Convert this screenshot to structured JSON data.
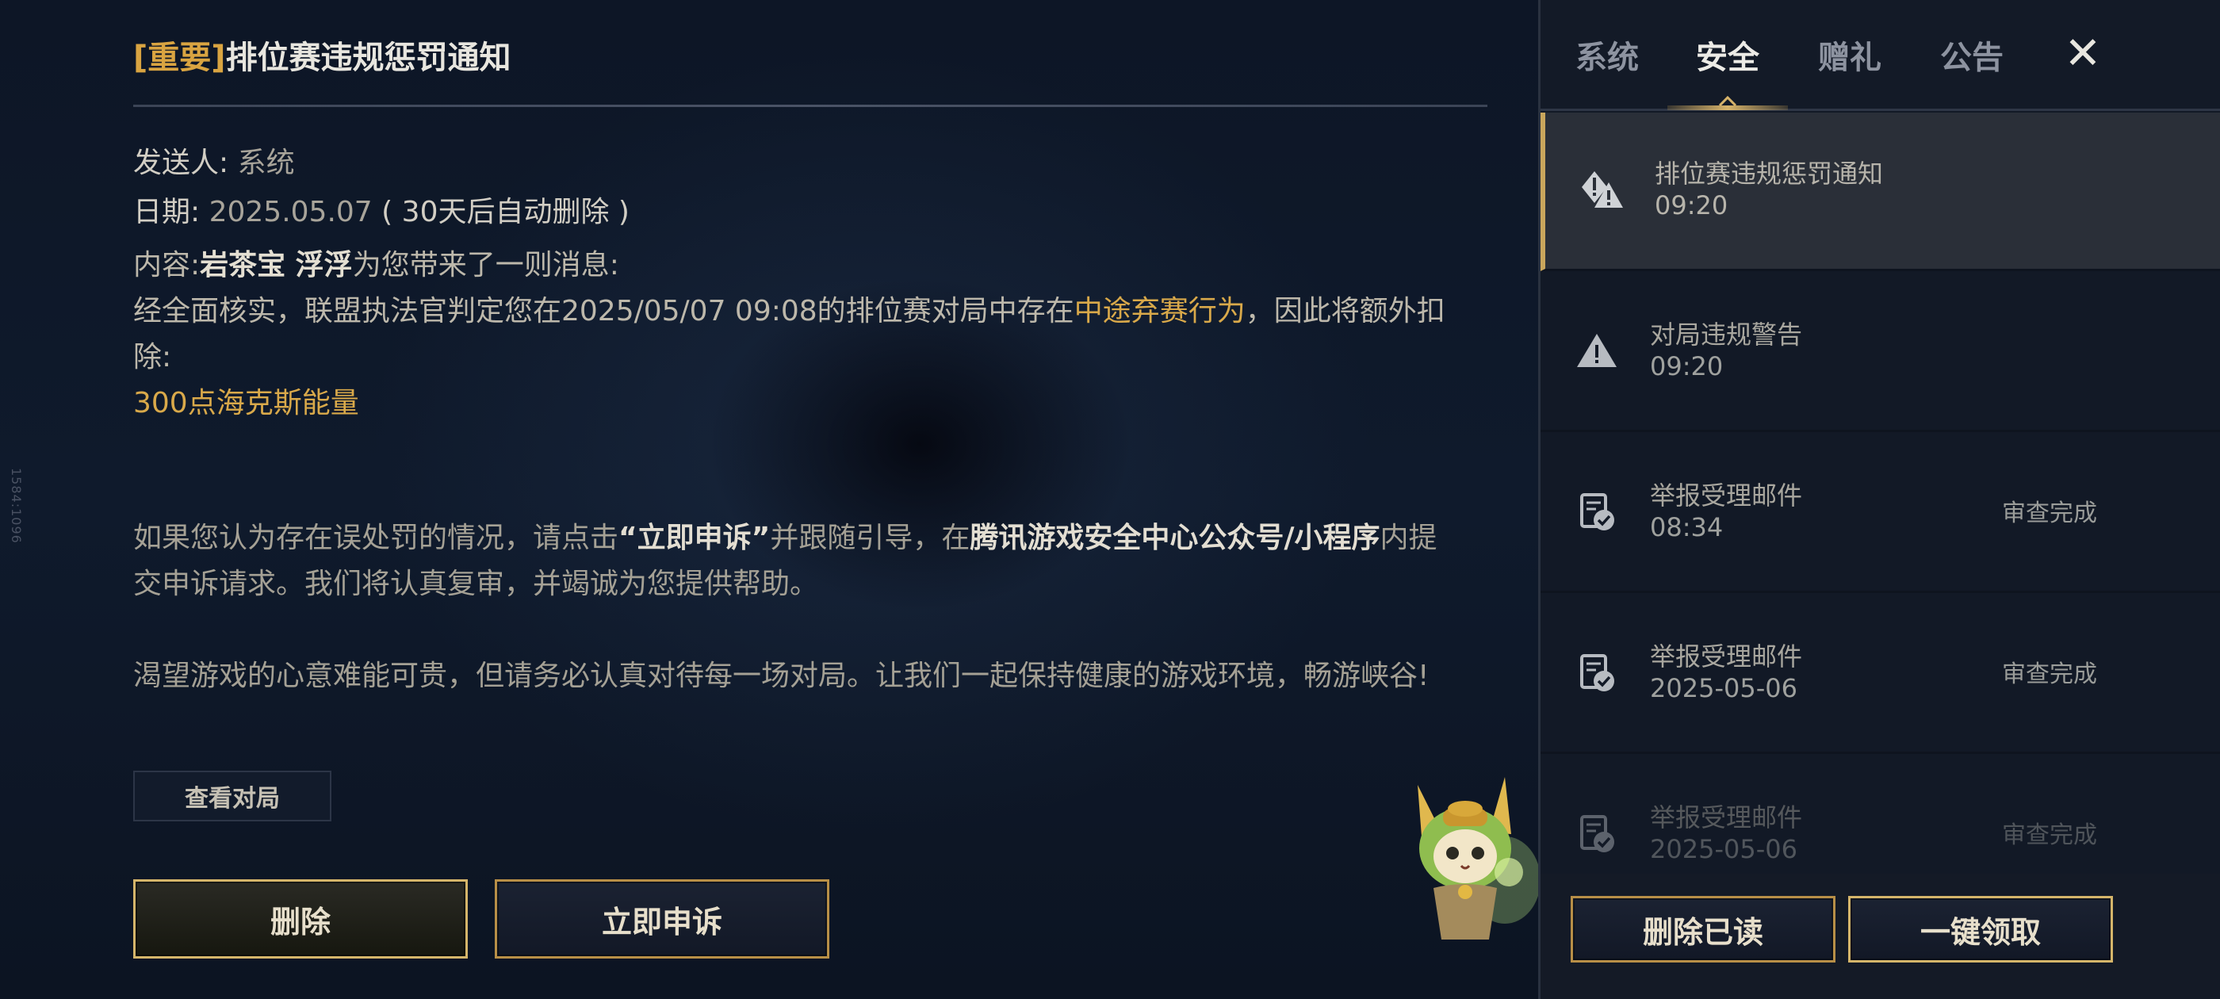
{
  "side_id": "1584:1096",
  "mail": {
    "title_tag": "[重要]",
    "title": "排位赛违规惩罚通知",
    "sender_label": "发送人:",
    "sender": "系统",
    "date_label": "日期:",
    "date": "2025.05.07",
    "date_note": "( 30天后自动删除 )",
    "content_label": "内容:",
    "content_from": "岩茶宝 浮浮",
    "content_intro": "为您带来了一则消息:",
    "content_body_1": "经全面核实，联盟执法官判定您在2025/05/07 09:08的排位赛对局中存在",
    "content_violation": "中途弃赛行为",
    "content_body_2": "，因此将额外扣除:",
    "penalty": "300点海克斯能量",
    "appeal_1": "如果您认为存在误处罚的情况，请点击",
    "appeal_link": "“立即申诉”",
    "appeal_2": "并跟随引导，在",
    "appeal_channel": "腾讯游戏安全中心公众号/小程序",
    "appeal_3": "内提交申诉请求。我们将认真复审，并竭诚为您提供帮助。",
    "closing": "渴望游戏的心意难能可贵，但请务必认真对待每一场对局。让我们一起保持健康的游戏环境，畅游峡谷!",
    "view_match": "查看对局",
    "delete": "删除",
    "appeal_now": "立即申诉"
  },
  "tabs": [
    {
      "label": "系统",
      "active": false
    },
    {
      "label": "安全",
      "active": true
    },
    {
      "label": "赠礼",
      "active": false
    },
    {
      "label": "公告",
      "active": false
    }
  ],
  "close_label": "✕",
  "messages": [
    {
      "icon": "warning-alert-icon",
      "title": "排位赛违规惩罚通知",
      "time": "09:20",
      "status": "",
      "selected": true
    },
    {
      "icon": "warning-triangle-icon",
      "title": "对局违规警告",
      "time": "09:20",
      "status": "",
      "selected": false
    },
    {
      "icon": "report-check-icon",
      "title": "举报受理邮件",
      "time": "08:34",
      "status": "审查完成",
      "selected": false
    },
    {
      "icon": "report-check-icon",
      "title": "举报受理邮件",
      "time": "2025-05-06",
      "status": "审查完成",
      "selected": false
    },
    {
      "icon": "report-check-icon",
      "title": "举报受理邮件",
      "time": "2025-05-06",
      "status": "审查完成",
      "selected": false
    }
  ],
  "footer": {
    "delete_read": "删除已读",
    "claim_all": "一键领取"
  },
  "colors": {
    "gold": "#d9a94a",
    "background": "#0d1626",
    "panel": "#121926"
  }
}
